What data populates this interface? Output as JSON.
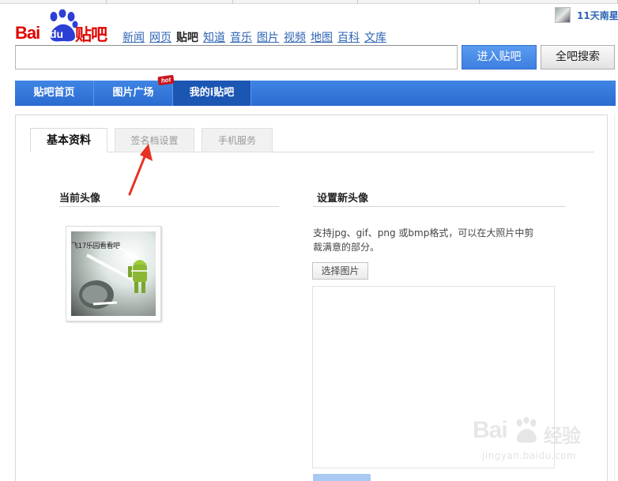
{
  "header": {
    "logo": {
      "bai": "Bai",
      "du": "du",
      "tieba": "贴吧"
    },
    "nav_links": [
      {
        "label": "新闻",
        "current": false
      },
      {
        "label": "网页",
        "current": false
      },
      {
        "label": "贴吧",
        "current": true
      },
      {
        "label": "知道",
        "current": false
      },
      {
        "label": "音乐",
        "current": false
      },
      {
        "label": "图片",
        "current": false
      },
      {
        "label": "视频",
        "current": false
      },
      {
        "label": "地图",
        "current": false
      },
      {
        "label": "百科",
        "current": false
      },
      {
        "label": "文库",
        "current": false
      }
    ],
    "user_name": "11天南星",
    "search": {
      "value": "",
      "enter_label": "进入贴吧",
      "search_all_label": "全吧搜索"
    }
  },
  "bluebar": {
    "items": [
      {
        "label": "贴吧首页",
        "active": false
      },
      {
        "label": "图片广场",
        "active": false
      },
      {
        "label": "我的i贴吧",
        "active": true
      }
    ],
    "hot_badge": "hot"
  },
  "tabs": [
    {
      "label": "基本资料",
      "active": true
    },
    {
      "label": "签名档设置",
      "active": false
    },
    {
      "label": "手机服务",
      "active": false
    }
  ],
  "current_avatar": {
    "title": "当前头像",
    "caption": "飞17乐园看看吧"
  },
  "new_avatar": {
    "title": "设置新头像",
    "support_text": "支持jpg、gif、png 或bmp格式，可以在大照片中剪裁满意的部分。",
    "choose_label": "选择图片"
  },
  "watermark": {
    "text": "Bai",
    "text2": "经验",
    "sub": "jingyan.baidu.com"
  },
  "colors": {
    "brand_red": "#e10602",
    "link_blue": "#2d64b3",
    "bar_blue": "#2a6bd0",
    "annotation_red": "#e53323"
  }
}
